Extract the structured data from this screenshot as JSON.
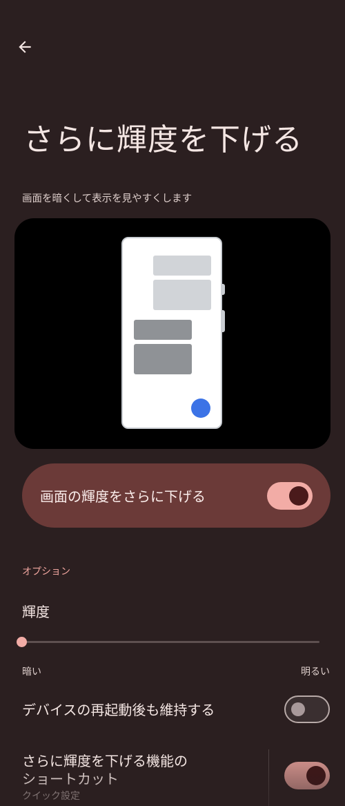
{
  "header": {
    "back_icon": "arrow-left-icon",
    "title": "さらに輝度を下げる",
    "subtitle": "画面を暗くして表示を見やすくします"
  },
  "preview": {
    "illustration": "phone-preview",
    "accent_dot_color": "#3c73e6"
  },
  "main_toggle": {
    "label": "画面の輝度をさらに下げる",
    "checked": true
  },
  "options": {
    "section_label": "オプション",
    "brightness": {
      "label": "輝度",
      "value": 0,
      "min_label": "暗い",
      "max_label": "明るい"
    },
    "persist_after_restart": {
      "label": "デバイスの再起動後も維持する",
      "checked": false
    },
    "shortcut": {
      "label_line1": "さらに輝度を下げる機能の",
      "label_line2": "ショートカット",
      "sublabel": "クイック設定",
      "checked": true
    }
  },
  "colors": {
    "background": "#2b1f20",
    "card": "#6b3a38",
    "accent": "#f2aca6",
    "section_label": "#f0a69f"
  }
}
